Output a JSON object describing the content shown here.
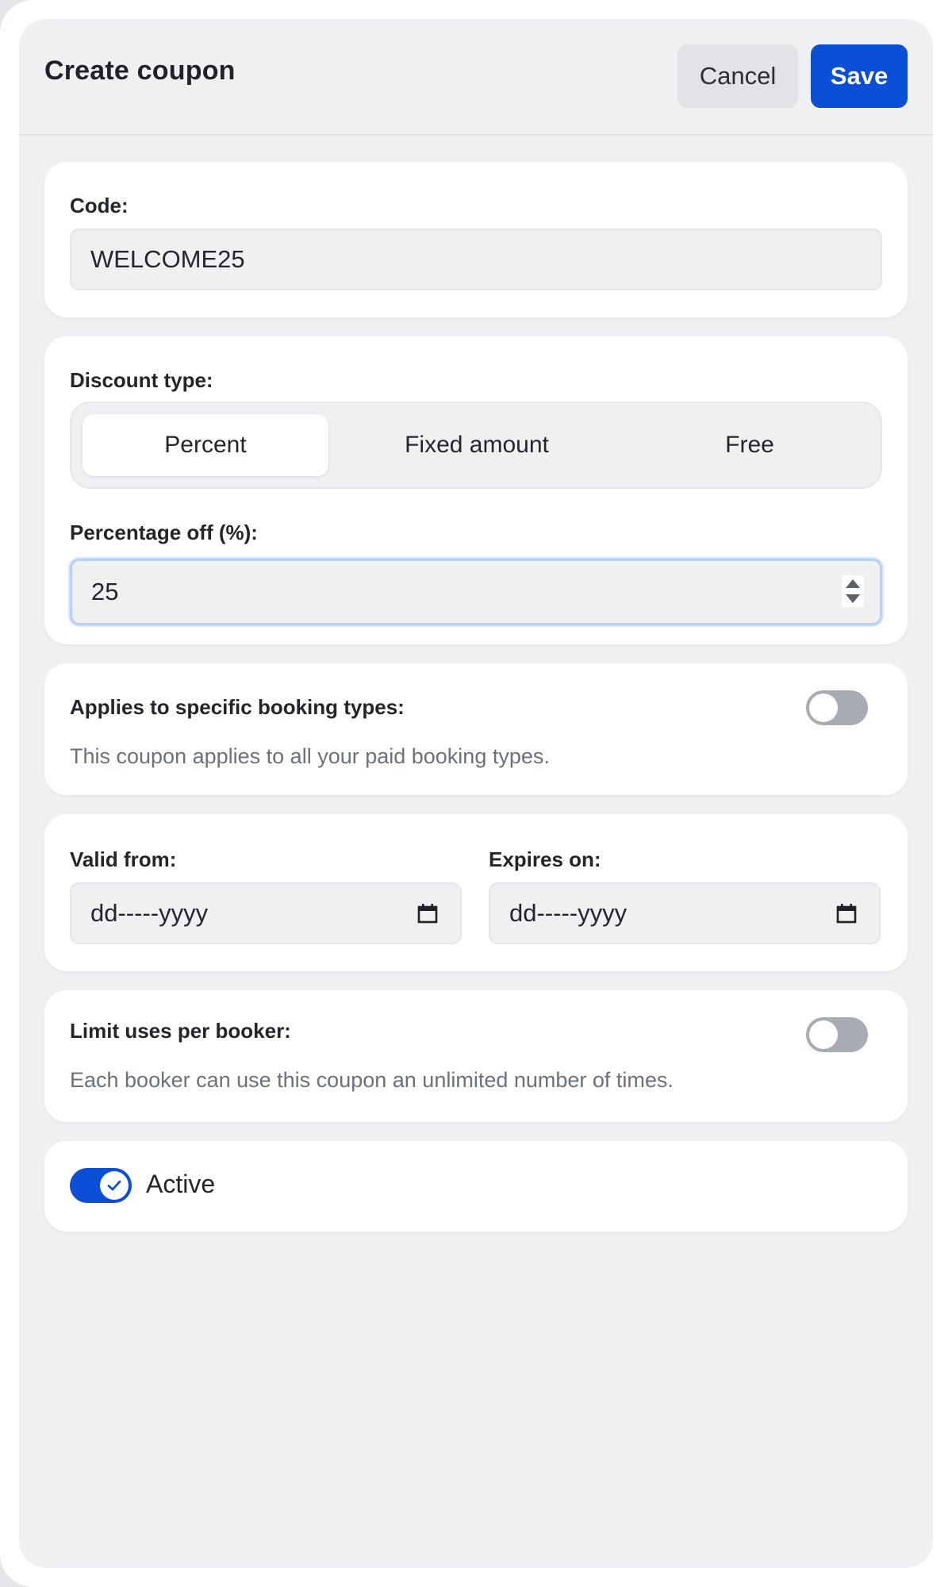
{
  "header": {
    "title": "Create coupon",
    "cancel_label": "Cancel",
    "save_label": "Save"
  },
  "code": {
    "label": "Code:",
    "value": "WELCOME25"
  },
  "discount": {
    "label": "Discount type:",
    "options": [
      "Percent",
      "Fixed amount",
      "Free"
    ],
    "selected": "Percent",
    "percentage_label": "Percentage off (%):",
    "percentage_value": "25"
  },
  "booking_types": {
    "label": "Applies to specific booking types:",
    "description": "This coupon applies to all your paid booking types.",
    "enabled": false
  },
  "dates": {
    "valid_from_label": "Valid from:",
    "valid_from_value": "dd-----yyyy",
    "expires_label": "Expires on:",
    "expires_value": "dd-----yyyy"
  },
  "limit_uses": {
    "label": "Limit uses per booker:",
    "description": "Each booker can use this coupon an unlimited number of times.",
    "enabled": false
  },
  "active": {
    "label": "Active",
    "enabled": true
  },
  "colors": {
    "accent": "#0a4fd6",
    "panel_background": "#eff0f2",
    "card_background": "#ffffff",
    "toggle_off": "#a7abb2"
  },
  "icons": {
    "calendar": "calendar-icon",
    "check": "check-icon",
    "stepper": "number-stepper-icon"
  }
}
